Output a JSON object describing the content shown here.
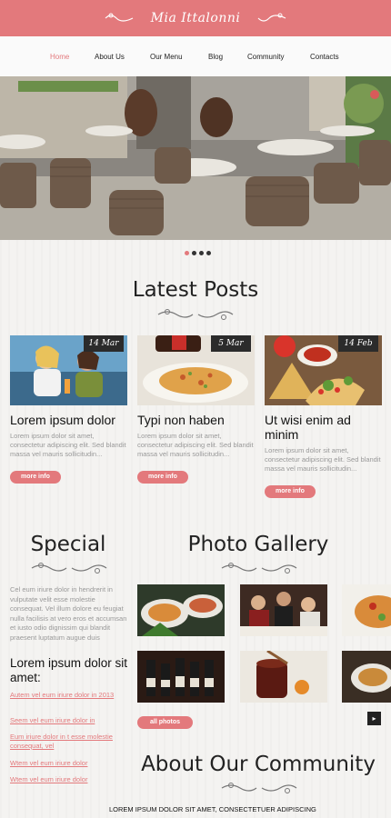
{
  "header": {
    "logo": "Mia Ittalonni"
  },
  "nav": {
    "items": [
      "Home",
      "About Us",
      "Our Menu",
      "Blog",
      "Community",
      "Contacts"
    ],
    "active_index": 0
  },
  "slider": {
    "dot_count": 4,
    "active_index": 0
  },
  "latest_posts": {
    "title": "Latest Posts",
    "posts": [
      {
        "date": "14 Mar",
        "title": "Lorem ipsum dolor",
        "text": "Lorem ipsum dolor sit amet, consectetur adipiscing elit. Sed blandit massa vel mauris sollicitudin...",
        "button": "more info"
      },
      {
        "date": "5 Mar",
        "title": "Typi non haben",
        "text": "Lorem ipsum dolor sit amet, consectetur adipiscing elit. Sed blandit massa vel mauris sollicitudin...",
        "button": "more info"
      },
      {
        "date": "14 Feb",
        "title": "Ut wisi enim ad minim",
        "text": "Lorem ipsum dolor sit amet, consectetur adipiscing elit. Sed blandit massa vel mauris sollicitudin...",
        "button": "more info"
      }
    ]
  },
  "special": {
    "title": "Special",
    "text": "Cel eum iriure dolor in hendrerit in vulputate velit esse molestie consequat. Vel illum dolore eu feugiat nulla facilisis at vero eros et accumsan et iusto odio dignissim qui blandit praesent luptatum augue duis",
    "heading": "Lorem ipsum dolor sit amet:",
    "links": [
      "Autem vel eum iriure dolor in 2013",
      "Seem vel eum iriure dolor in",
      "Eum iriure dolor in t esse molestie consequat, vel",
      "Wtem vel eum iriure dolor",
      "Wtem vel eum iriure dolor"
    ]
  },
  "gallery": {
    "title": "Photo Gallery",
    "button": "all photos",
    "next_icon": "chevron-right-icon"
  },
  "community": {
    "title": "About Our Community",
    "tagline": "LOREM IPSUM DOLOR SIT AMET, CONSECTETUER ADIPISCING"
  },
  "colors": {
    "accent": "#e3797c",
    "dark": "#2b2b2b"
  }
}
